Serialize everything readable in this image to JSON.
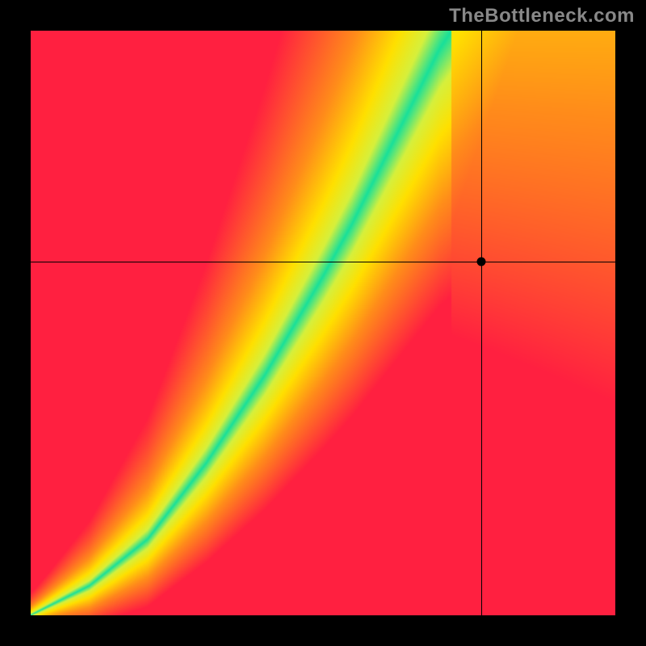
{
  "watermark": "TheBottleneck.com",
  "chart_data": {
    "type": "heatmap",
    "title": "",
    "xlabel": "",
    "ylabel": "",
    "xlim": [
      0,
      1
    ],
    "ylim": [
      0,
      1
    ],
    "grid": false,
    "legend": false,
    "crosshair": {
      "x": 0.772,
      "y": 0.604
    },
    "marker": {
      "x": 0.772,
      "y": 0.604
    },
    "heatmap_grid": {
      "nx": 100,
      "ny": 100
    },
    "color_stops": [
      {
        "pos": 0.0,
        "color": "#ff2040"
      },
      {
        "pos": 0.45,
        "color": "#ff8c1a"
      },
      {
        "pos": 0.72,
        "color": "#ffe000"
      },
      {
        "pos": 0.88,
        "color": "#d6f03c"
      },
      {
        "pos": 1.0,
        "color": "#18e09a"
      }
    ],
    "optimal_ridge": {
      "description": "green ridge y as function of x (normalized 0..1 origin bottom-left)",
      "points": [
        {
          "x": 0.0,
          "y": 0.0
        },
        {
          "x": 0.1,
          "y": 0.05
        },
        {
          "x": 0.2,
          "y": 0.13
        },
        {
          "x": 0.3,
          "y": 0.26
        },
        {
          "x": 0.4,
          "y": 0.41
        },
        {
          "x": 0.5,
          "y": 0.58
        },
        {
          "x": 0.55,
          "y": 0.67
        },
        {
          "x": 0.6,
          "y": 0.77
        },
        {
          "x": 0.65,
          "y": 0.87
        },
        {
          "x": 0.7,
          "y": 0.97
        },
        {
          "x": 0.72,
          "y": 1.0
        }
      ],
      "half_width": [
        {
          "x": 0.0,
          "w": 0.003
        },
        {
          "x": 0.3,
          "w": 0.02
        },
        {
          "x": 0.5,
          "w": 0.04
        },
        {
          "x": 0.7,
          "w": 0.055
        }
      ]
    },
    "field_model": {
      "note": "score(x,y)=1-clamp(|y-ridge(x)|/scale(x,y)); colored via color_stops",
      "scale_at_origin": 0.02,
      "scale_at_far": 0.7
    }
  }
}
